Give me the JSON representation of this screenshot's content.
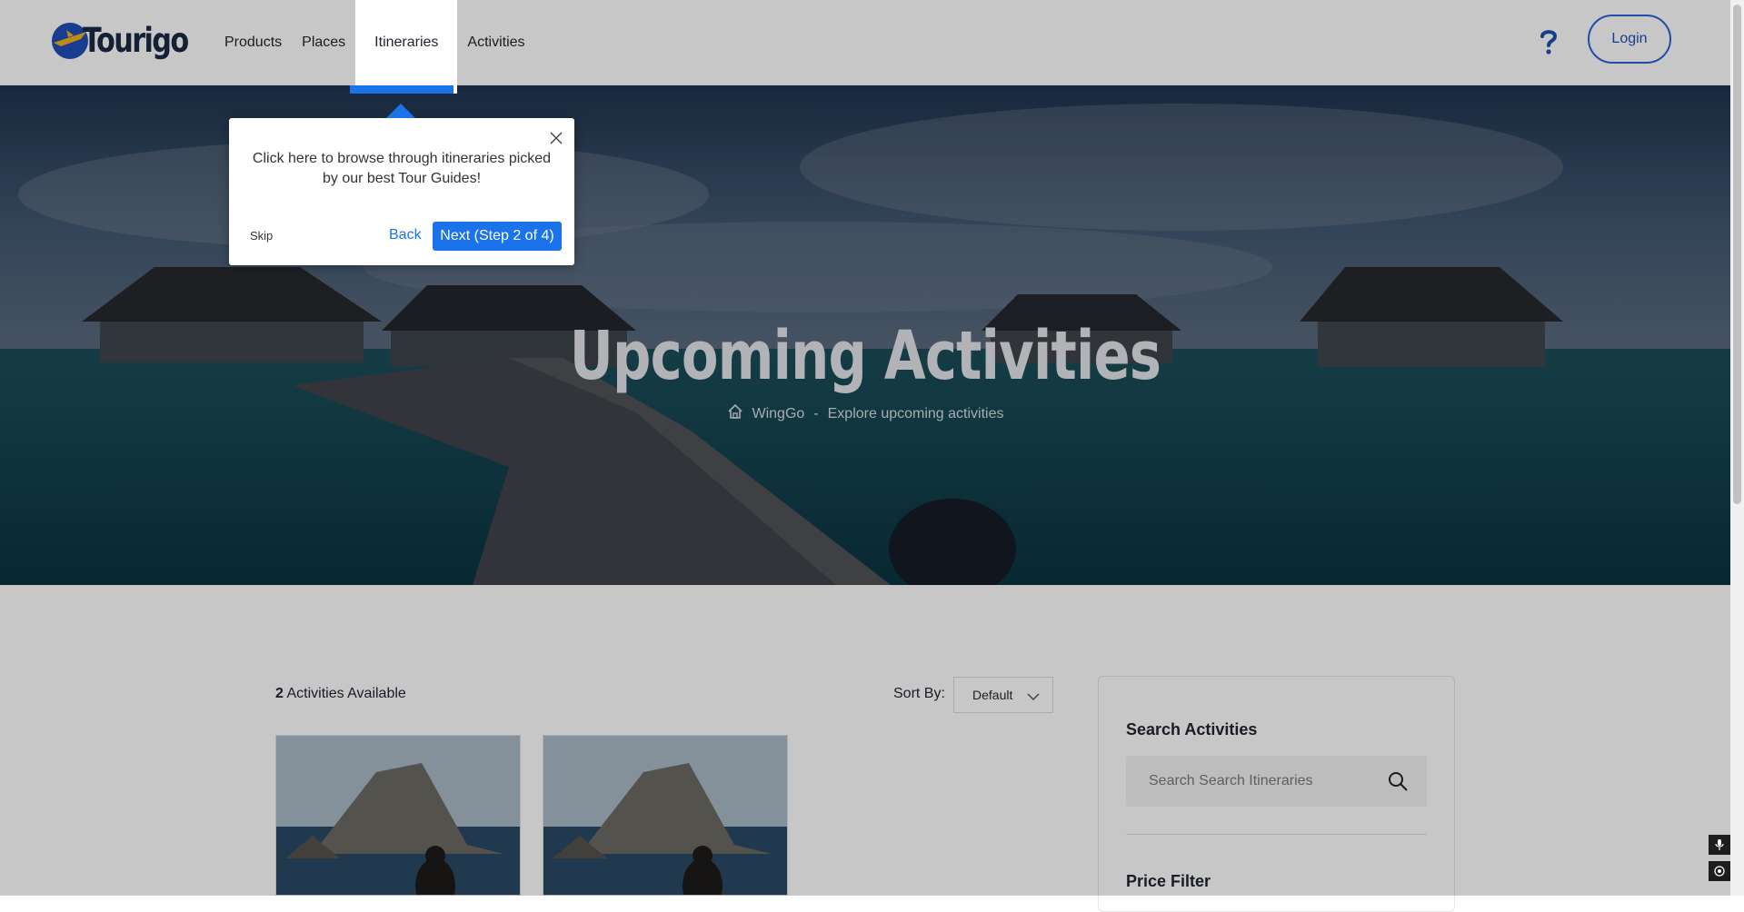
{
  "header": {
    "logo_text": "Tourigo",
    "nav": [
      "Products",
      "Places",
      "Itineraries",
      "Activities"
    ],
    "active_nav": "Itineraries",
    "help_icon": "question-mark-icon",
    "login_label": "Login"
  },
  "hero": {
    "title": "Upcoming Activities",
    "breadcrumb_home": "WingGo",
    "breadcrumb_separator": "-",
    "breadcrumb_current": "Explore upcoming activities"
  },
  "results": {
    "count": "2",
    "count_suffix": "Activities Available",
    "sort_label": "Sort By:",
    "sort_value": "Default"
  },
  "sidebar": {
    "search_heading": "Search Activities",
    "search_placeholder": "Search Search Itineraries",
    "price_heading": "Price Filter"
  },
  "tour": {
    "message": "Click here to browse through itineraries picked by our best Tour Guides!",
    "skip_label": "Skip",
    "back_label": "Back",
    "next_label": "Next (Step 2 of 4)"
  },
  "colors": {
    "accent": "#1a73e8",
    "login_border": "#2a64d6",
    "text": "#1f2430"
  }
}
